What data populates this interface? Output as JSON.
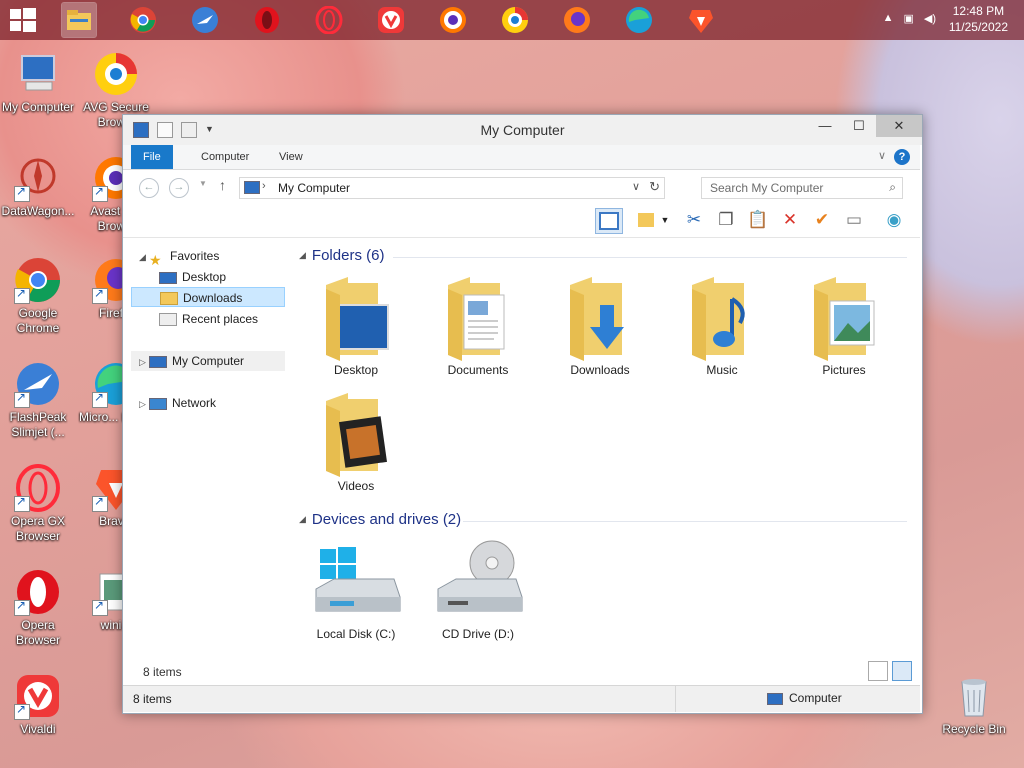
{
  "taskbar": {
    "clock_time": "12:48 PM",
    "clock_date": "11/25/2022",
    "apps": [
      "file-explorer",
      "chrome",
      "slimjet",
      "opera",
      "opera-gx",
      "vivaldi",
      "avast-browser",
      "avg-browser",
      "firefox",
      "edge",
      "brave"
    ]
  },
  "desktop": {
    "icons": [
      {
        "label": "My Computer"
      },
      {
        "label": "AVG Secure Brow..."
      },
      {
        "label": "DataWagon..."
      },
      {
        "label": "Avast S... Brow..."
      },
      {
        "label": "Google Chrome"
      },
      {
        "label": "Firef..."
      },
      {
        "label": "FlashPeak Slimjet (..."
      },
      {
        "label": "Micro... Edg..."
      },
      {
        "label": "Opera GX Browser"
      },
      {
        "label": "Brav..."
      },
      {
        "label": "Opera Browser"
      },
      {
        "label": "wini..."
      },
      {
        "label": "Vivaldi"
      },
      {
        "label": "Recycle Bin"
      }
    ]
  },
  "window": {
    "title": "My Computer",
    "ribbon_tabs": {
      "file": "File",
      "computer": "Computer",
      "view": "View"
    },
    "address_path": "My Computer",
    "search_placeholder": "Search My Computer",
    "nav": {
      "favorites": "Favorites",
      "desktop": "Desktop",
      "downloads": "Downloads",
      "recent": "Recent places",
      "my_computer": "My Computer",
      "network": "Network"
    },
    "folders_header": "Folders (6)",
    "folders": [
      "Desktop",
      "Documents",
      "Downloads",
      "Music",
      "Pictures",
      "Videos"
    ],
    "drives_header": "Devices and drives (2)",
    "drives": [
      "Local Disk (C:)",
      "CD Drive (D:)"
    ],
    "item_count": "8 items",
    "status_left": "8 items",
    "status_right": "Computer"
  },
  "colors": {
    "accent": "#1979ca",
    "group_header": "#1e3287",
    "selection": "#cce8ff"
  }
}
